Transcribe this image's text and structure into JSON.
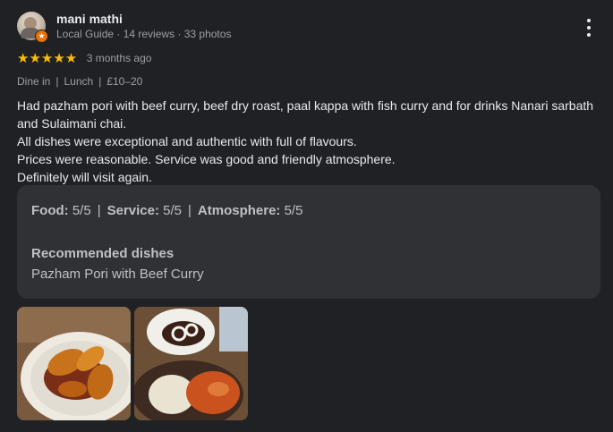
{
  "reviewer": {
    "name": "mani mathi",
    "subtitle": "Local Guide · 14 reviews · 33 photos",
    "avatar_icon": "user-avatar",
    "badge_icon": "local-guide-star-icon"
  },
  "rating": {
    "stars": 5,
    "stars_text": "★★★★★",
    "star_color": "#fbbc04",
    "time_ago": "3 months ago"
  },
  "meta": {
    "service": "Dine in",
    "meal": "Lunch",
    "price": "£10–20",
    "separator": "|"
  },
  "review_lines": [
    "Had pazham pori with beef curry, beef dry roast, paal kappa with fish curry and for drinks Nanari sarbath and Sulaimani chai.",
    "All dishes were exceptional and authentic with full of flavours.",
    "Prices were reasonable. Service was good and friendly atmosphere.",
    "Definitely will visit again."
  ],
  "attributes": {
    "food_label": "Food:",
    "food_value": "5/5",
    "service_label": "Service:",
    "service_value": "5/5",
    "atmosphere_label": "Atmosphere:",
    "atmosphere_value": "5/5",
    "separator": "|",
    "recommended_title": "Recommended dishes",
    "recommended_dish": "Pazham Pori with Beef Curry"
  },
  "photos": [
    {
      "alt": "plate of pazham pori with beef curry"
    },
    {
      "alt": "beef dry roast and paal kappa with fish curry"
    }
  ],
  "colors": {
    "background": "#202124",
    "card": "#303134",
    "text": "#e8eaed",
    "secondary_text": "#9aa0a6"
  }
}
